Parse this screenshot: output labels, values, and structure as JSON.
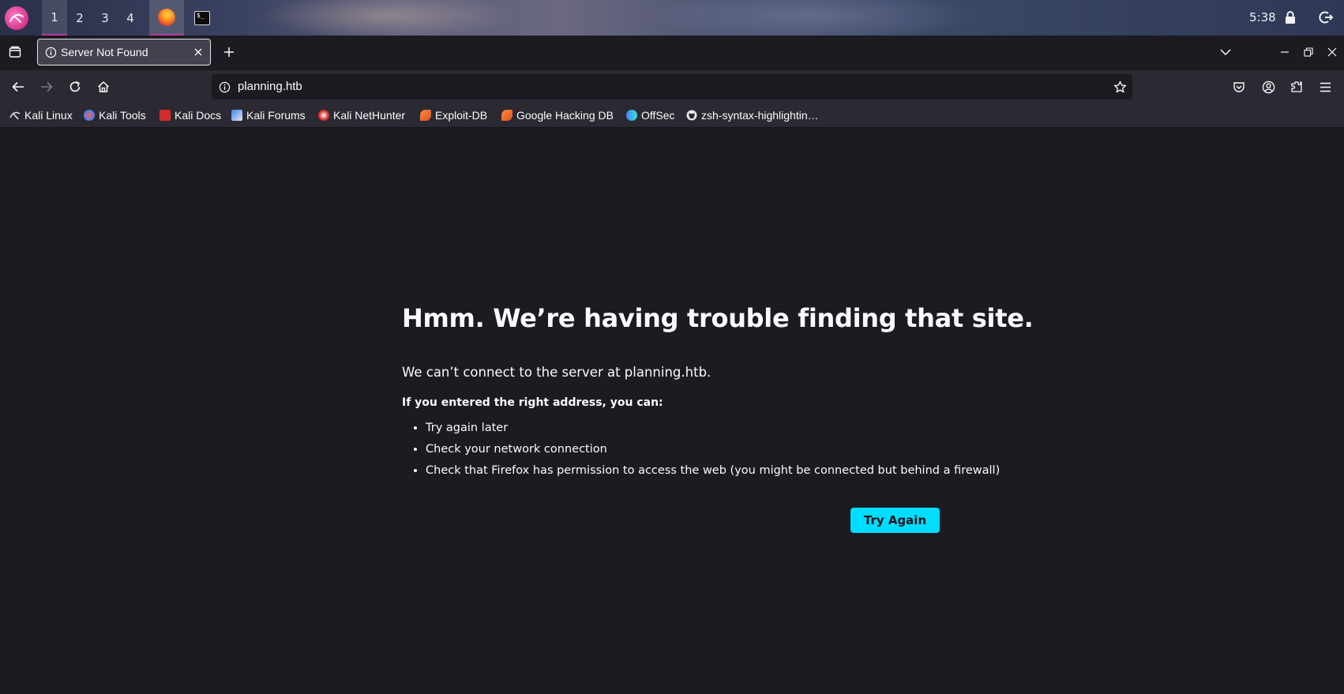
{
  "panel": {
    "workspaces": [
      "1",
      "2",
      "3",
      "4"
    ],
    "clock": "5:38",
    "icons": [
      "kali-menu-icon",
      "firefox-icon",
      "terminal-icon",
      "lock-icon",
      "logout-icon"
    ]
  },
  "browser": {
    "tab": {
      "title": "Server Not Found",
      "icon": "info-icon"
    },
    "url": "planning.htb",
    "bookmarks": [
      "Kali Linux",
      "Kali Tools",
      "Kali Docs",
      "Kali Forums",
      "Kali NetHunter",
      "Exploit-DB",
      "Google Hacking DB",
      "OffSec",
      "zsh-syntax-highlightin…"
    ]
  },
  "error_page": {
    "title": "Hmm. We’re having trouble finding that site.",
    "description": "We can’t connect to the server at planning.htb.",
    "hint": "If you entered the right address, you can:",
    "suggestions": [
      "Try again later",
      "Check your network connection",
      "Check that Firefox has permission to access the web (you might be connected but behind a firewall)"
    ],
    "button": "Try Again"
  },
  "colors": {
    "content_bg": "#1c1b22",
    "toolbar_bg": "#2b2a33",
    "accent_button": "#00ddff",
    "workspace_indicator": "#b13aa0"
  }
}
